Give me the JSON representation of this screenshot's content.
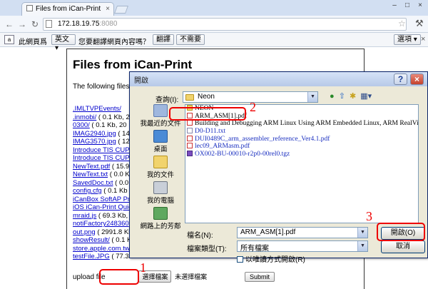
{
  "browser": {
    "tab_title": "Files from iCan-Print",
    "close_glyph": "×",
    "window_controls": [
      "–",
      "□",
      "×"
    ],
    "url_host": "172.18.19.75",
    "url_port": ":8080",
    "menu_glyph": "⚒"
  },
  "translate_bar": {
    "prompt_prefix": "此網頁爲",
    "language": "英文",
    "question": "您要翻譯網頁內容嗎？",
    "translate_button": "翻譯",
    "decline_button": "不需要",
    "options_button": "選項"
  },
  "page": {
    "title": "Files from iCan-Print",
    "intro": "The following files a",
    "files": [
      {
        "name": ".IMLTVPEvents/",
        "size": ""
      },
      {
        "name": ".inmobi/",
        "size": " ( 0.1 Kb, 2"
      },
      {
        "name": "0300/",
        "size": " ( 0.1 Kb, 20"
      },
      {
        "name": "IMAG2940.jpg",
        "size": " ( 14"
      },
      {
        "name": "IMAG3570.jpg",
        "size": " ( 12"
      },
      {
        "name": "Introduce TIS CUPS",
        "size": ""
      },
      {
        "name": "Introduce TIS CUPS",
        "size": ""
      },
      {
        "name": "NewText.pdf",
        "size": " ( 15.9"
      },
      {
        "name": "NewText.txt",
        "size": " ( 0.0 K"
      },
      {
        "name": "SavedDoc.txt",
        "size": " ( 0.0 K"
      },
      {
        "name": "config.cfg",
        "size": " ( 0.1 Kb"
      },
      {
        "name": "iCanBox SoftAP Print",
        "size": ""
      },
      {
        "name": "iOS iCan-Print Quick",
        "size": ""
      },
      {
        "name": "mraid.js",
        "size": " ( 69.3 Kb,"
      },
      {
        "name": "notiFactory248360",
        "size": ""
      },
      {
        "name": "out.png",
        "size": " ( 2991.8 Kb"
      },
      {
        "name": "showResult/",
        "size": " ( 0.1 Kb"
      },
      {
        "name": "store.apple.com.tw",
        "size": ""
      },
      {
        "name": "testFile.JPG",
        "size": " ( 77.3 K"
      }
    ],
    "upload_label": "upload file",
    "choose_button": "選擇檔案",
    "choose_status": "未選擇檔案",
    "submit_button": "Submit"
  },
  "dialog": {
    "title": "開啟",
    "help_glyph": "?",
    "close_glyph": "×",
    "look_in_label": "查詢(I):",
    "look_in_value": "Neon",
    "places": [
      "我最近的文件",
      "桌面",
      "我的文件",
      "我的電腦",
      "網路上的芳鄰"
    ],
    "files": [
      {
        "name": "NEON",
        "kind": "fold",
        "color": "black"
      },
      {
        "name": "ARM_ASM[1].pdf",
        "kind": "pdf",
        "color": "black"
      },
      {
        "name": "Building and Debugging ARM Linux Using ARM Embedded Linux, ARM RealView Development S",
        "kind": "pdf",
        "color": "black"
      },
      {
        "name": "D0-D11.txt",
        "kind": "txt",
        "color": "blue"
      },
      {
        "name": "DUI0489C_arm_assembler_reference_Ver4.1.pdf",
        "kind": "pdf",
        "color": "blue"
      },
      {
        "name": "lec09_ARMasm.pdf",
        "kind": "pdf",
        "color": "blue"
      },
      {
        "name": "OX002-BU-00010-r2p0-00rel0.tgz",
        "kind": "tgz",
        "color": "blue"
      }
    ],
    "filename_label": "檔名(N):",
    "filename_value": "ARM_ASM[1].pdf",
    "filetype_label": "檔案類型(T):",
    "filetype_value": "所有檔案",
    "readonly_label": "以唯讀方式開啟(R)",
    "open_button": "開啟(O)",
    "cancel_button": "取消"
  },
  "annotations": {
    "step1": "1",
    "step2": "2",
    "step3": "3",
    "color": "#e00000"
  }
}
